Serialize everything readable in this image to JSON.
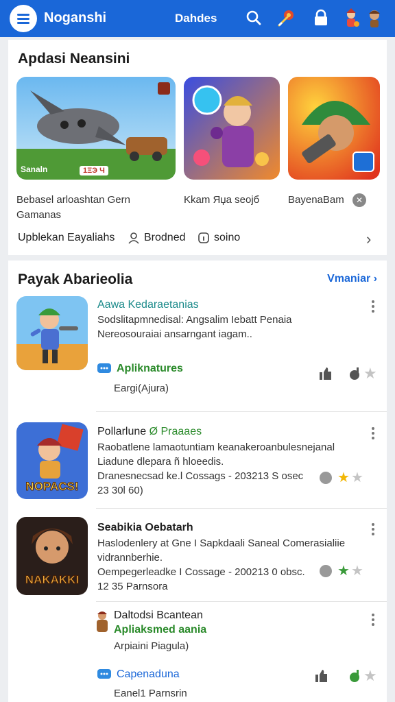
{
  "topbar": {
    "title": "Noganshi",
    "tab_label": "Dahdes"
  },
  "section1": {
    "title": "Apdasi Neansini",
    "cards": [
      {
        "caption": "Bebasel arloashtan Gern Gamanas",
        "badge": "Sanaln",
        "tag": "1ΞЭ Ч"
      },
      {
        "caption": "Kkam Яџа ѕеојб"
      },
      {
        "caption": "BayenaBam"
      }
    ],
    "filters": [
      {
        "label": "Upblekan Eayaliahs"
      },
      {
        "label": "Brodned"
      },
      {
        "label": "soino"
      }
    ]
  },
  "section2": {
    "title": "Payak Abarieolia",
    "more_label": "Vmaniar",
    "items": [
      {
        "name": "Aawa Kedaraetanias",
        "desc_line1": "Sodslitapmnedisal: Angsalim Iebatt Penaia",
        "desc_line2": "Nereosouraiai ansarngant iagam..",
        "sub_label": "Apliknatures",
        "sub_meta": "Eargi(Ajura)"
      },
      {
        "name_a": "Pollarlune",
        "name_b": "Ø Praaaes",
        "desc_line1": "Raobatlene lamaotuntiam keanakeroanbulesnejanal",
        "desc_line2": "Liadune dlepara ñ hloeedis.",
        "desc_line3": "Dranesnecsad ke.l Cossags - 203213 S osec",
        "desc_line4": "23 30l 60)",
        "icon_text": "NOPACS!"
      },
      {
        "name": "Seabikia Oebatarh",
        "desc_line1": "Haslodenlery at Gne I Sapkdaali Saneal Comerasialiie",
        "desc_line2": "vidrannberhie.",
        "desc_line3": "Oempegerleadke I Cossage - 200213 0 obsc.",
        "desc_line4": "12 35 Parnsora",
        "icon_text": "NAKAKKI"
      },
      {
        "name": "Daltodsi Bcantean",
        "sub_name": "Apliaksmed aania",
        "desc": "Arpiaini Piagula)",
        "sub_label": "Capenaduna",
        "sub_meta": "Eanel1 Parnsrin"
      }
    ]
  },
  "colors": {
    "brand": "#1a67d8",
    "accent_green": "#2a8a2a",
    "star_gold": "#f2b705"
  },
  "icons": [
    "menu-icon",
    "search-icon",
    "guitar-icon",
    "lock-icon",
    "character-avatar-icon",
    "character-avatar-icon-2",
    "chevron-right-icon",
    "star-icon",
    "thumbs-up-icon",
    "more-vert-icon"
  ]
}
